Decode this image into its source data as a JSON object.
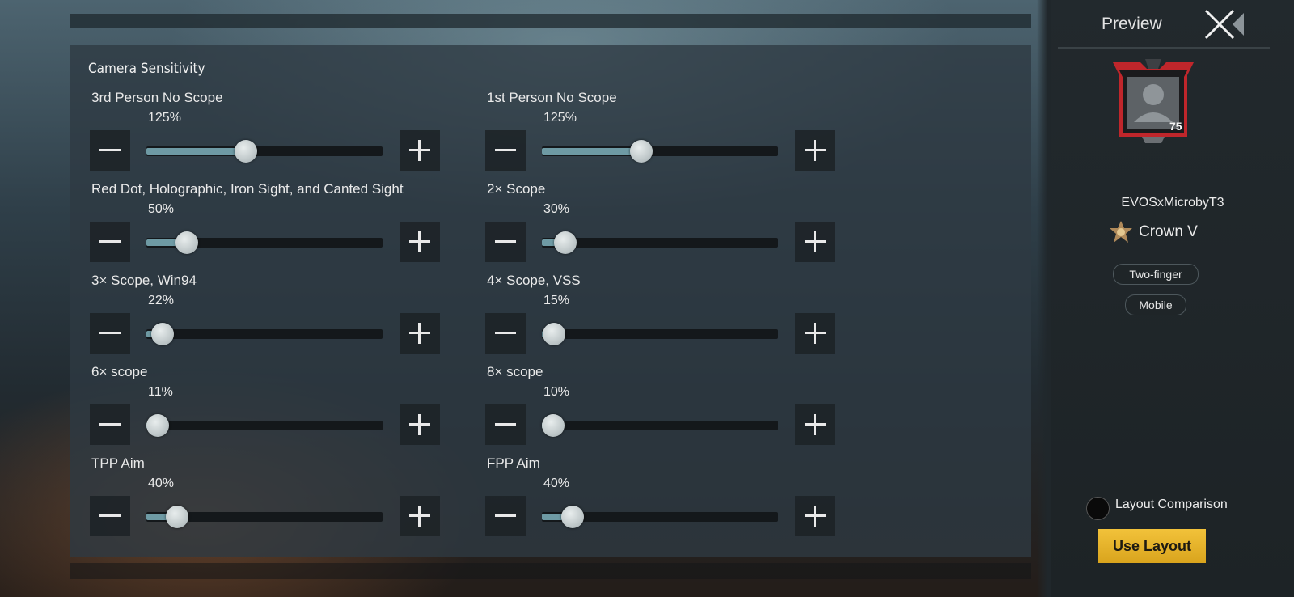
{
  "camera_sensitivity": {
    "title": "Camera Sensitivity",
    "settings": [
      {
        "label": "3rd Person No Scope",
        "value_text": "125%",
        "level": 0.42
      },
      {
        "label": "1st Person No Scope",
        "value_text": "125%",
        "level": 0.42
      },
      {
        "label": "Red Dot, Holographic, Iron Sight, and Canted Sight",
        "value_text": "50%",
        "level": 0.17
      },
      {
        "label": "2× Scope",
        "value_text": "30%",
        "level": 0.1
      },
      {
        "label": "3× Scope, Win94",
        "value_text": "22%",
        "level": 0.07
      },
      {
        "label": "4× Scope, VSS",
        "value_text": "15%",
        "level": 0.05
      },
      {
        "label": "6× scope",
        "value_text": "11%",
        "level": 0.03
      },
      {
        "label": "8× scope",
        "value_text": "10%",
        "level": 0.03
      },
      {
        "label": "TPP Aim",
        "value_text": "40%",
        "level": 0.13
      },
      {
        "label": "FPP Aim",
        "value_text": "40%",
        "level": 0.13
      }
    ]
  },
  "preview": {
    "title": "Preview",
    "level": "75",
    "player_name": "EVOSxMicrobyT3",
    "rank": "Crown V",
    "chips": [
      "Two-finger",
      "Mobile"
    ],
    "layout_comparison_label": "Layout Comparison",
    "use_layout_label": "Use Layout"
  },
  "colors": {
    "slider_fill": "#6e9aa4",
    "use_button": "#f2c23a",
    "avatar_frame": "#c0262b"
  }
}
